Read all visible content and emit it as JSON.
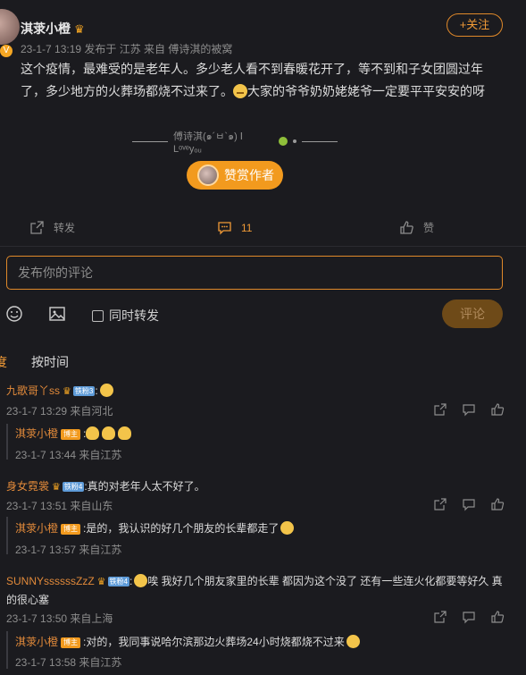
{
  "post": {
    "author": "淇莍小橙",
    "meta": "23-1-7 13:19  发布于 江苏  来自 傅诗淇的被窝",
    "follow_label": "+关注",
    "body_part1": "这个疫情，最难受的是老年人。多少老人看不到春暖花开了，等不到和子女团圆过年了，多少地方的火葬场都烧不过来了。",
    "body_part2": "大家的爷爷奶奶姥姥爷一定要平平安安的呀",
    "signature": "傅诗淇(๑´ㅂ`๑) Ⅰ  Lᵒᵛᵉyₒᵤ",
    "reward_label": "赞赏作者"
  },
  "actions": {
    "repost_label": "转发",
    "comment_count": "11",
    "like_label": "赞"
  },
  "composer": {
    "placeholder": "发布你的评论",
    "repost_checkbox_label": "同时转发",
    "submit_label": "评论"
  },
  "sort": {
    "hot_label": "度",
    "time_label": "按时间"
  },
  "comments": [
    {
      "name": "九歌哥丫ss",
      "level": "铁粉3",
      "text": ":",
      "meta": "23-1-7 13:29 来自河北",
      "reply": {
        "name": "淇莍小橙",
        "tag": "博主",
        "text": ":",
        "meta": "23-1-7 13:44 来自江苏"
      }
    },
    {
      "name": "身女霓裳",
      "level": "铁粉4",
      "text": ":真的对老年人太不好了。",
      "meta": "23-1-7 13:51 来自山东",
      "reply": {
        "name": "淇莍小橙",
        "tag": "博主",
        "text": ":是的，我认识的好几个朋友的长辈都走了",
        "meta": "23-1-7 13:57 来自江苏"
      }
    },
    {
      "name": "SUNNYssssssZzZ",
      "level": "铁粉4",
      "text": "唉 我好几个朋友家里的长辈 都因为这个没了 还有一些连火化都要等好久 真的很心塞",
      "meta": "23-1-7 13:50 来自上海",
      "reply": {
        "name": "淇莍小橙",
        "tag": "博主",
        "text": ":对的，我同事说哈尔滨那边火葬场24小时烧都烧不过来",
        "meta": "23-1-7 13:58 来自江苏"
      }
    }
  ],
  "colors": {
    "accent": "#f09a36",
    "background": "#1b1b1f",
    "name": "#e28a3a"
  }
}
